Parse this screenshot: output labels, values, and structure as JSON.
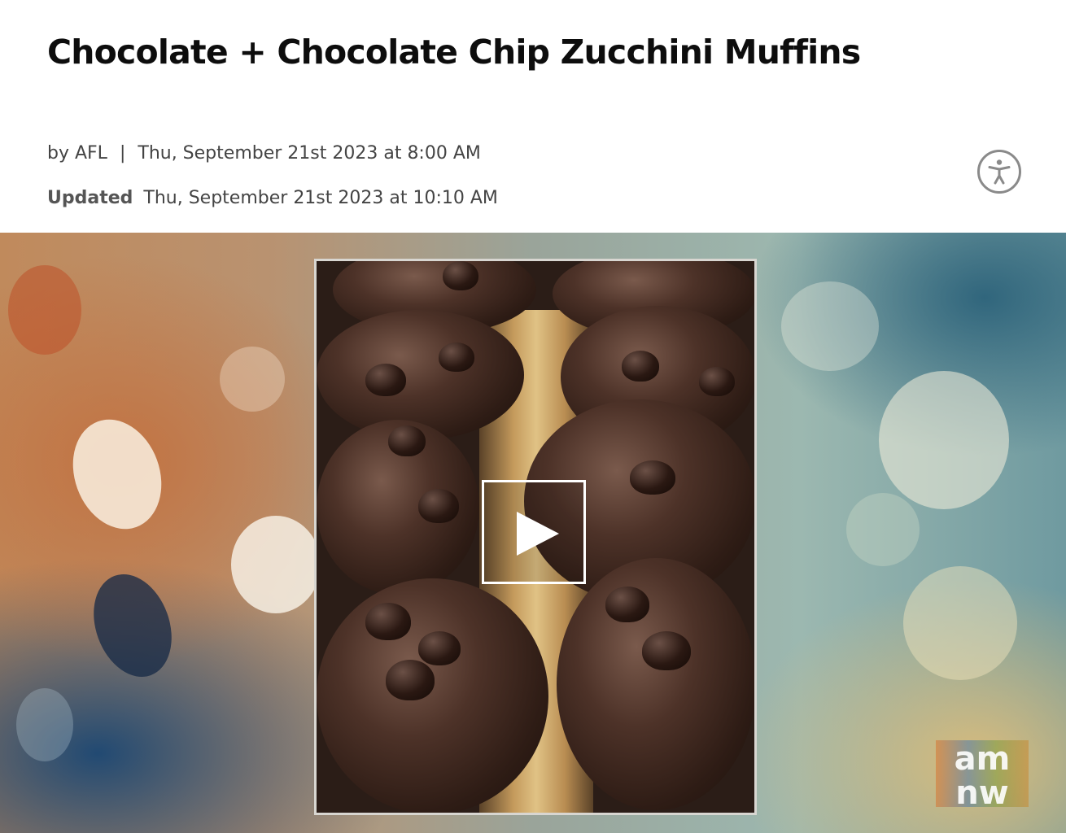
{
  "article": {
    "title": "Chocolate + Chocolate Chip Zucchini Muffins",
    "byline_author": "by AFL",
    "byline_separator": "|",
    "byline_date": "Thu, September 21st 2023 at 8:00 AM",
    "updated_label": "Updated",
    "updated_date": "Thu, September 21st 2023 at 10:10 AM"
  },
  "accessibility": {
    "icon": "accessibility-icon"
  },
  "video": {
    "play_icon": "play-icon",
    "logo_line1": "am",
    "logo_line2": "nw"
  },
  "colors": {
    "title": "#0d0d0d",
    "meta_text": "#444444",
    "a11y_border": "#8a8a8a",
    "play_border": "#ffffff"
  }
}
